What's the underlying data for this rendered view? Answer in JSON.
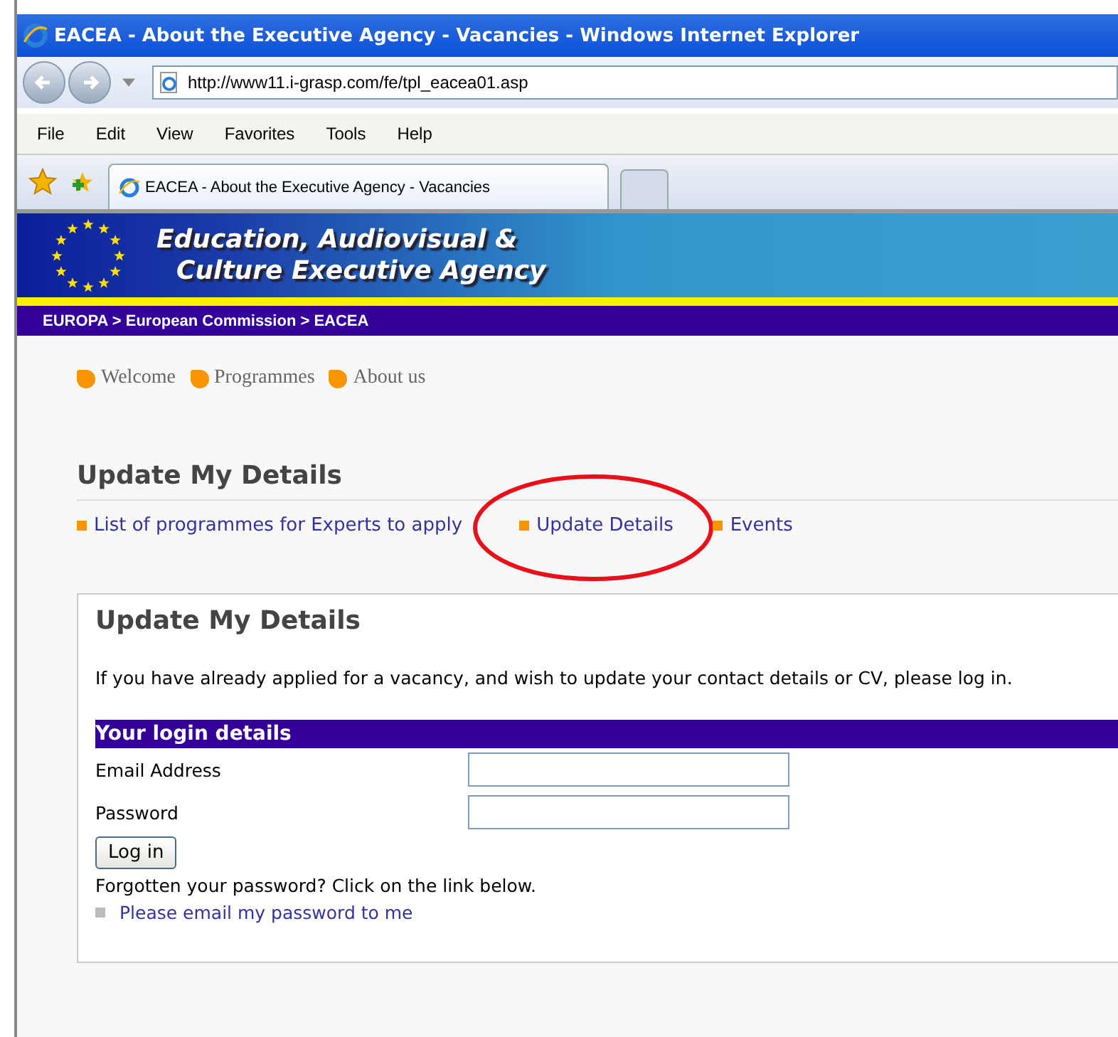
{
  "window": {
    "title": "EACEA - About the Executive Agency - Vacancies - Windows Internet Explorer"
  },
  "address_bar": {
    "url": "http://www11.i-grasp.com/fe/tpl_eacea01.asp"
  },
  "menu": [
    "File",
    "Edit",
    "View",
    "Favorites",
    "Tools",
    "Help"
  ],
  "tabs": [
    {
      "label": "EACEA - About the Executive Agency - Vacancies",
      "selected": true
    }
  ],
  "banner": {
    "title_line_1": "Education, Audiovisual &",
    "title_line_2": "Culture Executive Agency"
  },
  "breadcrumb": "EUROPA > European Commission > EACEA",
  "main_nav": [
    "Welcome",
    "Programmes",
    "About us"
  ],
  "section": {
    "heading": "Update My Details",
    "links": [
      {
        "label": "List of programmes for Experts to apply"
      },
      {
        "label": "Update Details"
      },
      {
        "label": "Events"
      }
    ]
  },
  "annotation": {
    "kind": "ellipse"
  },
  "panel": {
    "heading": "Update My Details",
    "intro": "If you have already applied for a vacancy, and wish to update your contact details or CV, please log in.",
    "form_title": "Your login details",
    "fields": [
      {
        "label": "Email Address"
      },
      {
        "label": "Password"
      }
    ],
    "button": "Log in",
    "forgot_text": "Forgotten your password? Click on the link below.",
    "forgot_link": "Please email my password to me"
  }
}
